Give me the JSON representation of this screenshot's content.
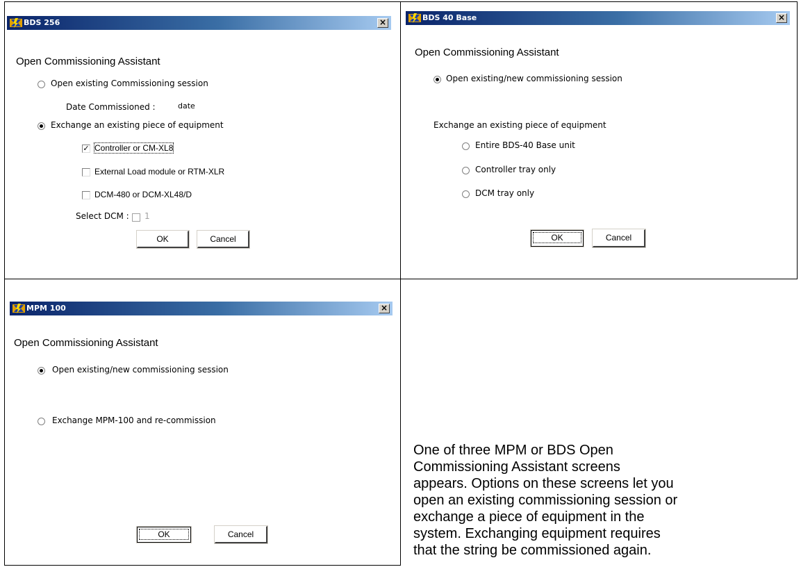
{
  "dialogs": [
    {
      "title": "BDS 256",
      "heading": "Open Commissioning Assistant",
      "radio_open_session": "Open existing Commissioning session",
      "date_label": "Date Commissioned :",
      "date_value": "date",
      "radio_exchange": "Exchange an existing piece of equipment",
      "check_controller": "Controller or CM-XL8",
      "check_external_load": "External Load module or RTM-XLR",
      "check_dcm": "DCM-480 or DCM-XL48/D",
      "select_dcm_label": "Select DCM :",
      "select_dcm_value": "1",
      "ok_label": "OK",
      "cancel_label": "Cancel"
    },
    {
      "title": "BDS 40 Base",
      "heading": "Open Commissioning Assistant",
      "radio_open_session": "Open existing/new commissioning session",
      "exchange_label": "Exchange an existing piece of equipment",
      "radio_entire_unit": "Entire BDS-40 Base unit",
      "radio_controller_tray": "Controller tray only",
      "radio_dcm_tray": "DCM tray only",
      "ok_label": "OK",
      "cancel_label": "Cancel"
    },
    {
      "title": "MPM 100",
      "heading": "Open Commissioning Assistant",
      "radio_open_session": "Open existing/new commissioning session",
      "radio_exchange": "Exchange MPM-100 and re-commission",
      "ok_label": "OK",
      "cancel_label": "Cancel"
    }
  ],
  "description": [
    "One of three MPM or BDS Open",
    "Commissioning Assistant screens",
    "appears. Options on these screens let you",
    "open an existing commissioning session or",
    "exchange a piece of equipment in the",
    "system. Exchanging equipment requires",
    "that the string be commissioned again."
  ],
  "icons": {
    "app_icon": "lightning-ribbon-icon",
    "close_icon": "close-icon"
  },
  "colors": {
    "titlebar_start": "#0a246a",
    "titlebar_end": "#a6caf0"
  }
}
